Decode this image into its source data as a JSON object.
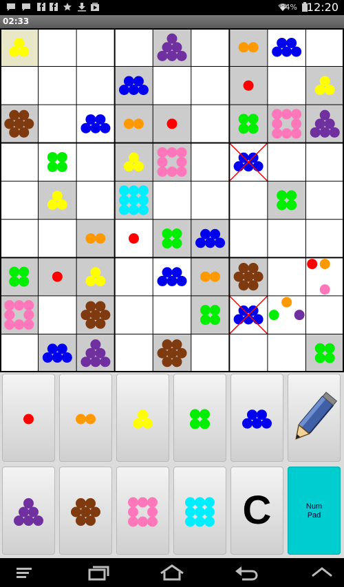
{
  "status_bar": {
    "battery_percent": "84%",
    "time": "12:20",
    "icons": [
      "message-icon",
      "message-icon",
      "facebook-icon",
      "facebook-icon",
      "star-icon",
      "download-icon",
      "media-icon",
      "wifi-icon",
      "battery-icon"
    ]
  },
  "game": {
    "timer": "02:33",
    "grid_size": 9,
    "colors": {
      "1": "#ff0000",
      "2": "#ff9900",
      "3": "#ffff00",
      "4": "#00ee00",
      "5": "#0000ee",
      "6": "#7030a0",
      "7": "#7f3a0f",
      "8": "#ff77bb",
      "9": "#00eeff",
      "grid_line": "#000000",
      "given_cell_bg": "#cccccc",
      "selected_cell_bg": "#e8e8c8",
      "error_mark": "#ff0000"
    },
    "cells": [
      [
        3,
        0,
        0,
        0,
        6,
        0,
        2,
        5,
        0
      ],
      [
        0,
        0,
        0,
        5,
        0,
        0,
        1,
        0,
        3
      ],
      [
        7,
        0,
        5,
        2,
        1,
        0,
        4,
        8,
        6
      ],
      [
        0,
        4,
        0,
        3,
        8,
        0,
        5,
        0,
        0
      ],
      [
        0,
        3,
        0,
        9,
        0,
        0,
        0,
        4,
        0
      ],
      [
        0,
        0,
        2,
        1,
        4,
        5,
        0,
        0,
        0
      ],
      [
        4,
        1,
        3,
        0,
        5,
        2,
        7,
        0,
        0
      ],
      [
        8,
        0,
        7,
        0,
        0,
        4,
        5,
        0,
        0
      ],
      [
        0,
        5,
        6,
        0,
        7,
        0,
        0,
        0,
        4
      ]
    ],
    "given": [
      [
        0,
        0,
        0,
        0,
        1,
        0,
        1,
        0,
        0
      ],
      [
        0,
        0,
        0,
        1,
        0,
        0,
        1,
        0,
        1
      ],
      [
        1,
        0,
        0,
        1,
        1,
        0,
        1,
        1,
        1
      ],
      [
        0,
        0,
        0,
        1,
        1,
        0,
        0,
        0,
        0
      ],
      [
        0,
        1,
        0,
        1,
        0,
        0,
        0,
        1,
        0
      ],
      [
        0,
        0,
        1,
        0,
        1,
        1,
        0,
        0,
        0
      ],
      [
        1,
        1,
        1,
        0,
        0,
        1,
        1,
        0,
        0
      ],
      [
        1,
        0,
        1,
        0,
        0,
        1,
        0,
        0,
        0
      ],
      [
        0,
        1,
        1,
        0,
        1,
        0,
        0,
        0,
        1
      ]
    ],
    "errors": [
      [
        3,
        6
      ],
      [
        7,
        6
      ]
    ],
    "selected": [
      0,
      0
    ],
    "notes": [
      {
        "row": 6,
        "col": 8,
        "values": [
          1,
          2,
          8
        ]
      },
      {
        "row": 7,
        "col": 7,
        "values": [
          2,
          4,
          6
        ]
      }
    ]
  },
  "keypad": {
    "row1": [
      1,
      2,
      3,
      4,
      5
    ],
    "row2": [
      6,
      7,
      8,
      9
    ],
    "pencil_icon": "pencil-icon",
    "clear_label": "C",
    "numpad_label": "Num\nPad"
  },
  "nav_bar": {
    "icons": [
      "menu-icon",
      "recent-apps-icon",
      "home-icon",
      "back-icon",
      "up-arrow-icon"
    ]
  }
}
